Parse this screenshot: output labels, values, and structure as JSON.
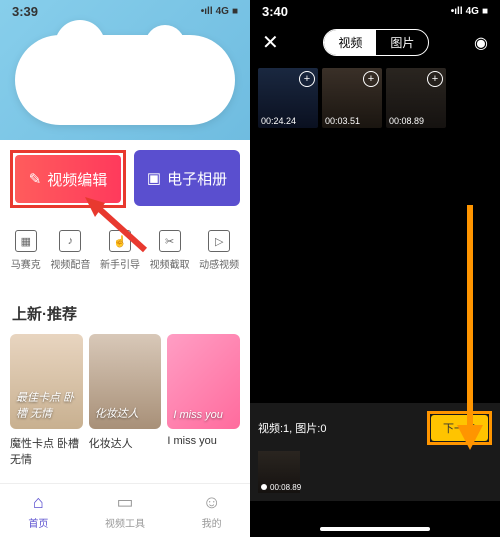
{
  "left": {
    "status": {
      "time": "3:39",
      "signal": "4G",
      "battery": "■"
    },
    "main_buttons": {
      "edit": {
        "label": "视频编辑",
        "icon": "✎"
      },
      "album": {
        "label": "电子相册",
        "icon": "▣"
      }
    },
    "tools": [
      {
        "label": "马赛克"
      },
      {
        "label": "视频配音"
      },
      {
        "label": "新手引导"
      },
      {
        "label": "视频截取"
      },
      {
        "label": "动感视频"
      }
    ],
    "section_title": "上新·推荐",
    "cards": [
      {
        "title": "魔性卡点 卧槽无情",
        "overlay": "最佳卡点\n卧槽 无情"
      },
      {
        "title": "化妆达人",
        "overlay": "化妆达人"
      },
      {
        "title": "I miss you",
        "overlay": "I miss you"
      }
    ],
    "nav": [
      {
        "label": "首页",
        "active": true
      },
      {
        "label": "视频工具",
        "active": false
      },
      {
        "label": "我的",
        "active": false
      }
    ]
  },
  "right": {
    "status": {
      "time": "3:40",
      "signal": "4G"
    },
    "tabs": {
      "video": "视频",
      "image": "图片"
    },
    "media": [
      {
        "duration": "00:24.24"
      },
      {
        "duration": "00:03.51"
      },
      {
        "duration": "00:08.89"
      }
    ],
    "selection": {
      "text": "视频:1, 图片:0",
      "next": "下一步",
      "thumb_duration": "00:08.89"
    }
  }
}
